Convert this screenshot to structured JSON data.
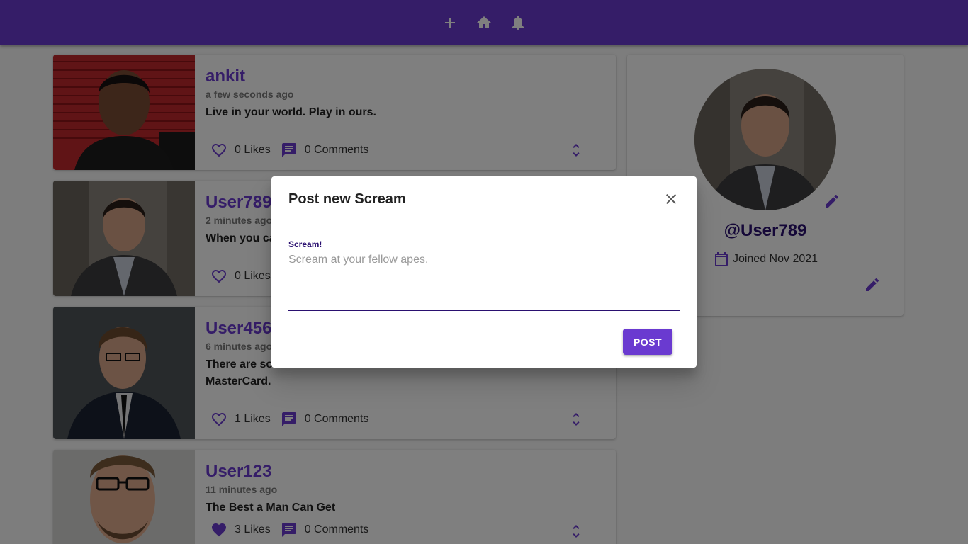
{
  "nav": {
    "icons": [
      "add-icon",
      "home-icon",
      "notifications-icon"
    ],
    "color": "#6a3ad0"
  },
  "screams": [
    {
      "handle": "ankit",
      "time": "a few seconds ago",
      "body": "Live in your world. Play in ours.",
      "likes": "0 Likes",
      "comments": "0 Comments",
      "liked": false
    },
    {
      "handle": "User789",
      "time": "2 minutes ago",
      "body": "When you ca",
      "likes": "0 Likes",
      "comments": "",
      "liked": false
    },
    {
      "handle": "User456",
      "time": "6 minutes ago",
      "body_line1": "There are so",
      "body_line2": "MasterCard.",
      "likes": "1 Likes",
      "comments": "0 Comments",
      "liked": false
    },
    {
      "handle": "User123",
      "time": "11 minutes ago",
      "body": "The Best a Man Can Get",
      "likes": "3 Likes",
      "comments": "0 Comments",
      "liked": true
    }
  ],
  "profile": {
    "handle": "@User789",
    "joined": "Joined Nov 2021"
  },
  "dialog": {
    "title": "Post new Scream",
    "field_label": "Scream!",
    "placeholder": "Scream at your fellow apes.",
    "value": "",
    "submit_label": "POST"
  },
  "colors": {
    "primary": "#6a3ad0",
    "primary_dark": "#2a1070",
    "overlay": "rgba(0,0,0,0.5)"
  }
}
